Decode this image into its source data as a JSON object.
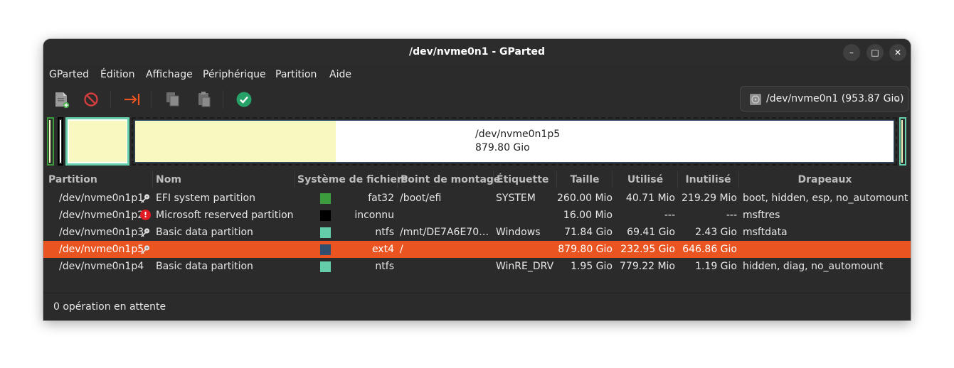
{
  "window": {
    "title": "/dev/nvme0n1 - GParted"
  },
  "menubar": [
    "GParted",
    "Édition",
    "Affichage",
    "Périphérique",
    "Partition",
    "Aide"
  ],
  "toolbar": {
    "icons": [
      "new-partition-icon",
      "delete-icon",
      "resize-move-icon",
      "copy-icon",
      "paste-icon",
      "apply-icon"
    ]
  },
  "device": {
    "label": "/dev/nvme0n1 (953.87 Gio)"
  },
  "diskmap": {
    "selected_label": "/dev/nvme0n1p5",
    "selected_size": "879.80 Gio",
    "used_fraction": 0.265
  },
  "table": {
    "headers": [
      "Partition",
      "Nom",
      "Système de fichiers",
      "Point de montage",
      "Étiquette",
      "Taille",
      "Utilisé",
      "Inutilisé",
      "Drapeaux"
    ],
    "rows": [
      {
        "partition": "/dev/nvme0n1p1",
        "icon": "key-icon",
        "name": "EFI system partition",
        "fs": "fat32",
        "fs_color": "#3c9b3c",
        "mount": "/boot/efi",
        "label": "SYSTEM",
        "size": "260.00 Mio",
        "used": "40.71 Mio",
        "unused": "219.29 Mio",
        "flags": "boot, hidden, esp, no_automount"
      },
      {
        "partition": "/dev/nvme0n1p2",
        "icon": "warning-icon",
        "name": "Microsoft reserved partition",
        "fs": "inconnu",
        "fs_color": "#000000",
        "mount": "",
        "label": "",
        "size": "16.00 Mio",
        "used": "---",
        "unused": "---",
        "flags": "msftres"
      },
      {
        "partition": "/dev/nvme0n1p3",
        "icon": "key-icon",
        "name": "Basic data partition",
        "fs": "ntfs",
        "fs_color": "#66cdaa",
        "mount": "/mnt/DE7A6E70…",
        "label": "Windows",
        "size": "71.84 Gio",
        "used": "69.41 Gio",
        "unused": "2.43 Gio",
        "flags": "msftdata"
      },
      {
        "partition": "/dev/nvme0n1p5",
        "icon": "key-icon",
        "name": "",
        "fs": "ext4",
        "fs_color": "#314e6c",
        "mount": "/",
        "label": "",
        "size": "879.80 Gio",
        "used": "232.95 Gio",
        "unused": "646.86 Gio",
        "flags": "",
        "selected": true
      },
      {
        "partition": "/dev/nvme0n1p4",
        "icon": "",
        "name": "Basic data partition",
        "fs": "ntfs",
        "fs_color": "#66cdaa",
        "mount": "",
        "label": "WinRE_DRV",
        "size": "1.95 Gio",
        "used": "779.22 Mio",
        "unused": "1.19 Gio",
        "flags": "hidden, diag, no_automount"
      }
    ]
  },
  "status": {
    "text": "0 opération en attente"
  },
  "colors": {
    "selection": "#e95420",
    "fat32": "#3c9b3c",
    "ntfs": "#66cdaa",
    "ext4": "#314e6c",
    "used_space": "#f8f8c0"
  }
}
